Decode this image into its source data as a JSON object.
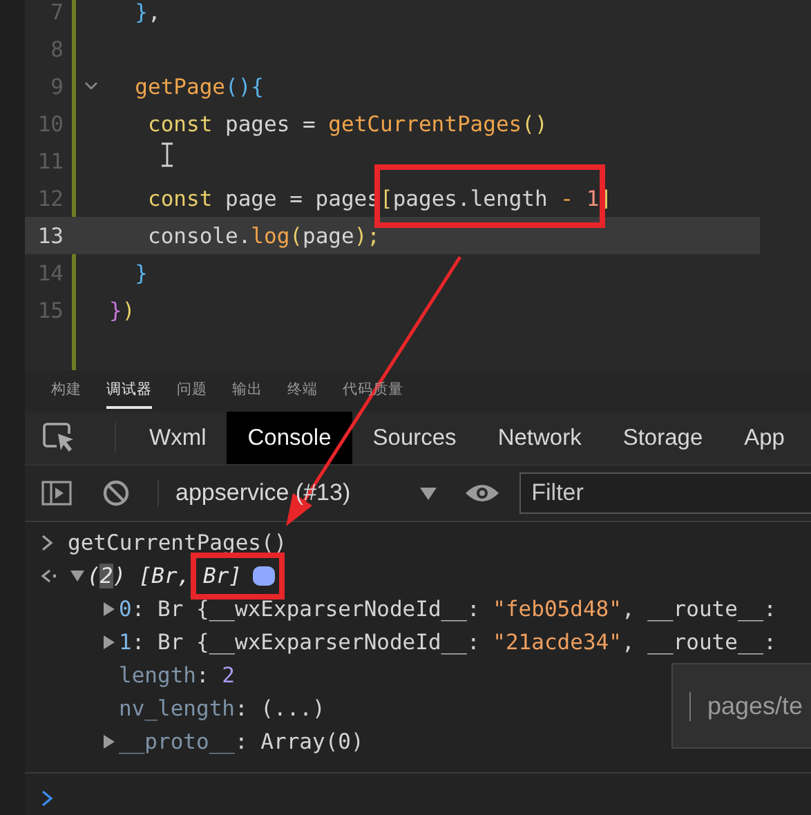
{
  "editor": {
    "lines": [
      {
        "number": "7",
        "current": false,
        "tokens": [
          {
            "text": "  }",
            "kind": "brace"
          },
          {
            "text": ",",
            "kind": "plain"
          }
        ]
      },
      {
        "number": "8",
        "current": false
      },
      {
        "number": "9",
        "current": false,
        "fold": true,
        "tokens": [
          {
            "text": "  getPage",
            "kind": "func"
          },
          {
            "text": "(){",
            "kind": "brace"
          }
        ]
      },
      {
        "number": "10",
        "current": false,
        "tokens": [
          {
            "text": "   const",
            "kind": "keyword"
          },
          {
            "text": " pages = ",
            "kind": "plain"
          },
          {
            "text": "getCurrentPages",
            "kind": "func"
          },
          {
            "text": "()",
            "kind": "paren"
          }
        ]
      },
      {
        "number": "11",
        "current": false
      },
      {
        "number": "12",
        "current": false,
        "tokens": [
          {
            "text": "   const",
            "kind": "keyword"
          },
          {
            "text": " page = pages",
            "kind": "plain"
          },
          {
            "text": "[",
            "kind": "paren"
          },
          {
            "text": "pages.length",
            "kind": "plain"
          },
          {
            "text": " - ",
            "kind": "operator"
          },
          {
            "text": "1",
            "kind": "number"
          },
          {
            "text": "]",
            "kind": "paren"
          }
        ]
      },
      {
        "number": "13",
        "current": true,
        "tokens": [
          {
            "text": "   console.",
            "kind": "plain"
          },
          {
            "text": "log",
            "kind": "func"
          },
          {
            "text": "(",
            "kind": "paren"
          },
          {
            "text": "page",
            "kind": "plain"
          },
          {
            "text": ");",
            "kind": "paren"
          }
        ]
      },
      {
        "number": "14",
        "current": false,
        "tokens": [
          {
            "text": "  }",
            "kind": "brace"
          }
        ]
      },
      {
        "number": "15",
        "current": false,
        "tokens": [
          {
            "text": "}",
            "kind": "brace2"
          },
          {
            "text": ")",
            "kind": "paren"
          }
        ]
      }
    ]
  },
  "panel_tabs": [
    {
      "label": "构建",
      "selected": false
    },
    {
      "label": "调试器",
      "selected": true
    },
    {
      "label": "问题",
      "selected": false
    },
    {
      "label": "输出",
      "selected": false
    },
    {
      "label": "终端",
      "selected": false
    },
    {
      "label": "代码质量",
      "selected": false
    }
  ],
  "devtools_tabs": [
    {
      "label": "Wxml",
      "selected": false
    },
    {
      "label": "Console",
      "selected": true
    },
    {
      "label": "Sources",
      "selected": false
    },
    {
      "label": "Network",
      "selected": false
    },
    {
      "label": "Storage",
      "selected": false
    },
    {
      "label": "App",
      "selected": false
    }
  ],
  "console_toolbar": {
    "context": "appservice (#13)",
    "filter": {
      "placeholder": "Filter"
    }
  },
  "console": {
    "entries": [
      {
        "kind": "input",
        "tokens": [
          {
            "text": "getCurrentPages()",
            "kind": "plain"
          }
        ]
      },
      {
        "kind": "result",
        "expanded": true,
        "tokens": [
          {
            "text": "(",
            "kind": "italic"
          },
          {
            "text": "2",
            "kind": "selection"
          },
          {
            "text": ") [Br, Br]",
            "kind": "italic"
          }
        ],
        "children": [
          {
            "expandable": true,
            "tokens": [
              {
                "text": "0",
                "kind": "index"
              },
              {
                "text": ": Br {__wxExparserNodeId__: ",
                "kind": "plain"
              },
              {
                "text": "\"feb05d48\"",
                "kind": "string"
              },
              {
                "text": ", __route__:",
                "kind": "plain"
              }
            ]
          },
          {
            "expandable": true,
            "tokens": [
              {
                "text": "1",
                "kind": "index"
              },
              {
                "text": ": Br {__wxExparserNodeId__: ",
                "kind": "plain"
              },
              {
                "text": "\"21acde34\"",
                "kind": "string"
              },
              {
                "text": ", __route__:",
                "kind": "plain"
              }
            ]
          },
          {
            "expandable": false,
            "tokens": [
              {
                "text": "length",
                "kind": "key"
              },
              {
                "text": ": ",
                "kind": "plain"
              },
              {
                "text": "2",
                "kind": "number"
              }
            ]
          },
          {
            "expandable": false,
            "tokens": [
              {
                "text": "nv_length",
                "kind": "key"
              },
              {
                "text": ": (...)",
                "kind": "plain"
              }
            ]
          },
          {
            "expandable": true,
            "tokens": [
              {
                "text": "__proto__",
                "kind": "key"
              },
              {
                "text": ": Array(0)",
                "kind": "plain"
              }
            ]
          }
        ]
      }
    ]
  },
  "tooltip": {
    "text": "pages/te"
  }
}
